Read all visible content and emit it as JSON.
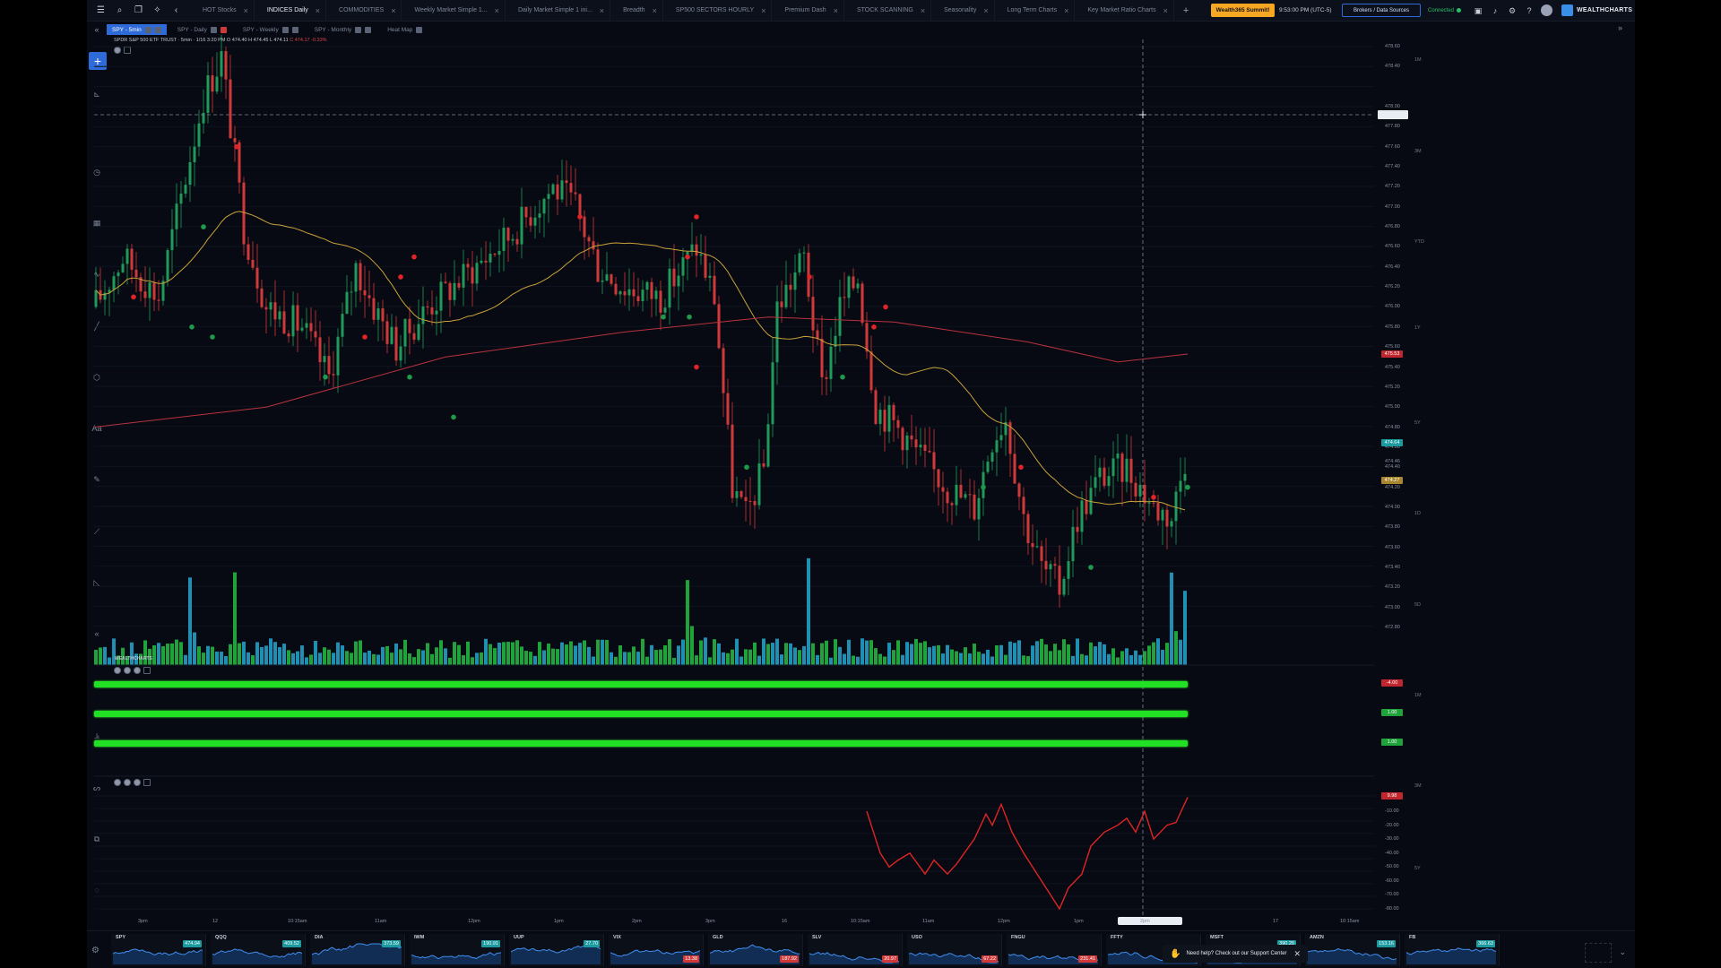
{
  "top_tabs": [
    {
      "label": "HOT Stocks",
      "active": false
    },
    {
      "label": "INDICES Daily",
      "active": true
    },
    {
      "label": "COMMODITIES",
      "active": false
    },
    {
      "label": "Weekly Market Simple 1...",
      "active": false
    },
    {
      "label": "Daily Market Simple 1 ini...",
      "active": false
    },
    {
      "label": "Breadth",
      "active": false
    },
    {
      "label": "SP500 SECTORS HOURLY",
      "active": false
    },
    {
      "label": "Premium Dash",
      "active": false
    },
    {
      "label": "STOCK SCANNING",
      "active": false
    },
    {
      "label": "Seasonality",
      "active": false
    },
    {
      "label": "Long Term Charts",
      "active": false
    },
    {
      "label": "Key Market Ratio Charts",
      "active": false
    }
  ],
  "header": {
    "summit_label": "Wealth365 Summit!",
    "clock": "9:53:00 PM (UTC-5)",
    "brokers_label": "Brokers / Data Sources",
    "connected_label": "Connected",
    "logo_text": "WEALTHCHARTS"
  },
  "sub_tabs": [
    {
      "label": "SPY - 5min",
      "active": true
    },
    {
      "label": "SPY - Daily",
      "active": false
    },
    {
      "label": "SPY - Weekly",
      "active": false
    },
    {
      "label": "SPY - Monthly",
      "active": false
    },
    {
      "label": "Heat Map",
      "active": false
    }
  ],
  "legend": {
    "text": "SPDR S&P 500 ETF TRUST · 5min · 1/16 3:20 PM O 474.40 H 474.45 L 474.11",
    "change": "C 474.17 -0.33%"
  },
  "volume_label": "WEALTHCHARTS",
  "price_axis": {
    "ticks": [
      "478.60",
      "478.40",
      "478.00",
      "477.80",
      "477.60",
      "477.40",
      "477.20",
      "477.00",
      "476.80",
      "476.60",
      "476.40",
      "476.20",
      "476.00",
      "475.80",
      "475.60",
      "475.40",
      "475.20",
      "475.00",
      "474.80",
      "474.60",
      "474.46",
      "474.40",
      "474.20",
      "474.00",
      "473.80",
      "473.60",
      "473.40",
      "473.20",
      "473.00",
      "472.80"
    ],
    "tag_red": "475.53",
    "tag_teal": "474.64",
    "tag_gold": "474.27",
    "pane2_tags": [
      "-4.00",
      "1.00",
      "1.00"
    ],
    "pane3_ticks": [
      "1.00",
      "0.00",
      "-10.00",
      "-20.00",
      "-30.00",
      "-40.00",
      "-50.00",
      "-60.00",
      "-70.00",
      "-80.00"
    ],
    "pane3_tag": "9.98"
  },
  "right_strip": [
    "1M",
    "3M",
    "YTD",
    "1Y",
    "5Y",
    "1D",
    "5D",
    "1M",
    "3M",
    "5Y"
  ],
  "time_axis": [
    "3pm",
    "12",
    "10:15am",
    "11am",
    "12pm",
    "1pm",
    "2pm",
    "3pm",
    "16",
    "10:15am",
    "11am",
    "12pm",
    "1pm",
    "2pm",
    "17",
    "10:15am"
  ],
  "chart_data": {
    "type": "candlestick",
    "series_count": 3,
    "price_range": [
      472.8,
      478.6
    ],
    "close_last": 474.17,
    "volume_pane": true,
    "oscillator_range": [
      -80,
      1
    ]
  },
  "colors": {
    "up": "#1f9a5a",
    "down": "#d0393a",
    "ema": "#c9a23a",
    "sma": "#b9333f",
    "volume_up": "#1fa33a",
    "volume_teal": "#1f8fb3",
    "bar_green": "#22e024",
    "oscillator": "#e02424"
  },
  "watchlist": [
    {
      "symbol": "SPY",
      "price": "474.94",
      "color": "#1b9aa0"
    },
    {
      "symbol": "QQQ",
      "price": "409.52",
      "color": "#1b9aa0"
    },
    {
      "symbol": "DIA",
      "price": "373.59",
      "color": "#1b9aa0"
    },
    {
      "symbol": "IWM",
      "price": "190.91",
      "color": "#1b9aa0"
    },
    {
      "symbol": "UUP",
      "price": "27.70",
      "color": "#1b9aa0"
    },
    {
      "symbol": "VIX",
      "price": "13.38",
      "color": "#d0393a"
    },
    {
      "symbol": "GLD",
      "price": "187.92",
      "color": "#d0393a"
    },
    {
      "symbol": "SLV",
      "price": "20.97",
      "color": "#d0393a"
    },
    {
      "symbol": "USO",
      "price": "67.22",
      "color": "#d0393a"
    },
    {
      "symbol": "FNGU",
      "price": "231.41",
      "color": "#d0393a"
    },
    {
      "symbol": "FFTY",
      "price": "",
      "color": "#1b9aa0"
    },
    {
      "symbol": "MSFT",
      "price": "390.20",
      "color": "#1b9aa0"
    },
    {
      "symbol": "AMZN",
      "price": "153.16",
      "color": "#1b9aa0"
    },
    {
      "symbol": "FB",
      "price": "366.63",
      "color": "#1b9aa0"
    }
  ],
  "help_banner": "Need help? Check out our Support Center"
}
